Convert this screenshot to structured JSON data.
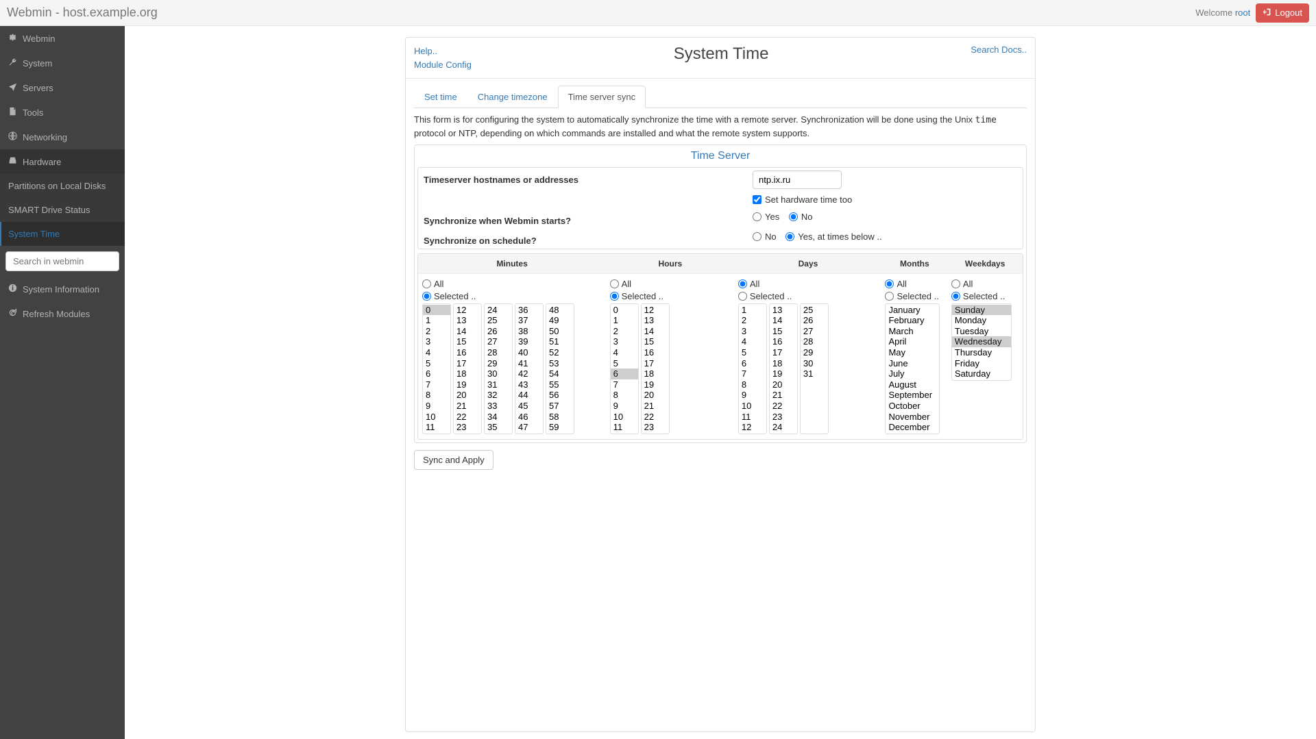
{
  "topbar": {
    "brand": "Webmin - host.example.org",
    "welcome_prefix": "Welcome ",
    "welcome_user": "root",
    "logout_label": "Logout"
  },
  "sidebar": {
    "items": [
      {
        "label": "Webmin",
        "icon": "gear"
      },
      {
        "label": "System",
        "icon": "wrench"
      },
      {
        "label": "Servers",
        "icon": "send"
      },
      {
        "label": "Tools",
        "icon": "file"
      },
      {
        "label": "Networking",
        "icon": "globe"
      },
      {
        "label": "Hardware",
        "icon": "hdd",
        "active": true
      }
    ],
    "subitems": [
      {
        "label": "Partitions on Local Disks"
      },
      {
        "label": "SMART Drive Status"
      },
      {
        "label": "System Time",
        "current": true
      }
    ],
    "search_placeholder": "Search in webmin",
    "footer_items": [
      {
        "label": "System Information",
        "icon": "info"
      },
      {
        "label": "Refresh Modules",
        "icon": "refresh"
      }
    ]
  },
  "header": {
    "help_link": "Help..",
    "config_link": "Module Config",
    "title": "System Time",
    "search_docs": "Search Docs.."
  },
  "tabs": [
    {
      "label": "Set time"
    },
    {
      "label": "Change timezone"
    },
    {
      "label": "Time server sync",
      "active": true
    }
  ],
  "description": {
    "before": "This form is for configuring the system to automatically synchronize the time with a remote server. Synchronization will be done using the Unix ",
    "code": "time",
    "after": " protocol or NTP, depending on which commands are installed and what the remote system supports."
  },
  "section": {
    "title": "Time Server",
    "hostnames_label": "Timeserver hostnames or addresses",
    "hostnames_value": "ntp.ix.ru",
    "hardware_label": "Set hardware time too",
    "hardware_checked": true,
    "sync_start_label": "Synchronize when Webmin starts?",
    "sync_start_yes": "Yes",
    "sync_start_no": "No",
    "sync_start_value": "no",
    "sync_sched_label": "Synchronize on schedule?",
    "sync_sched_no": "No",
    "sync_sched_yes": "Yes, at times below ..",
    "sync_sched_value": "yes"
  },
  "schedule": {
    "headers": {
      "minutes": "Minutes",
      "hours": "Hours",
      "days": "Days",
      "months": "Months",
      "weekdays": "Weekdays"
    },
    "all_label": "All",
    "selected_label": "Selected ..",
    "minutes": {
      "mode": "selected",
      "selected": [
        0
      ],
      "lists": [
        [
          0,
          1,
          2,
          3,
          4,
          5,
          6,
          7,
          8,
          9,
          10,
          11
        ],
        [
          12,
          13,
          14,
          15,
          16,
          17,
          18,
          19,
          20,
          21,
          22,
          23
        ],
        [
          24,
          25,
          26,
          27,
          28,
          29,
          30,
          31,
          32,
          33,
          34,
          35
        ],
        [
          36,
          37,
          38,
          39,
          40,
          41,
          42,
          43,
          44,
          45,
          46,
          47
        ],
        [
          48,
          49,
          50,
          51,
          52,
          53,
          54,
          55,
          56,
          57,
          58,
          59
        ]
      ]
    },
    "hours": {
      "mode": "selected",
      "selected": [
        6
      ],
      "lists": [
        [
          0,
          1,
          2,
          3,
          4,
          5,
          6,
          7,
          8,
          9,
          10,
          11
        ],
        [
          12,
          13,
          14,
          15,
          16,
          17,
          18,
          19,
          20,
          21,
          22,
          23
        ]
      ]
    },
    "days": {
      "mode": "all",
      "selected": [],
      "lists": [
        [
          1,
          2,
          3,
          4,
          5,
          6,
          7,
          8,
          9,
          10,
          11,
          12
        ],
        [
          13,
          14,
          15,
          16,
          17,
          18,
          19,
          20,
          21,
          22,
          23,
          24
        ],
        [
          25,
          26,
          27,
          28,
          29,
          30,
          31
        ]
      ]
    },
    "months": {
      "mode": "all",
      "selected": [],
      "list": [
        "January",
        "February",
        "March",
        "April",
        "May",
        "June",
        "July",
        "August",
        "September",
        "October",
        "November",
        "December"
      ]
    },
    "weekdays": {
      "mode": "selected",
      "selected": [
        "Sunday",
        "Wednesday"
      ],
      "list": [
        "Sunday",
        "Monday",
        "Tuesday",
        "Wednesday",
        "Thursday",
        "Friday",
        "Saturday"
      ]
    }
  },
  "submit_label": "Sync and Apply"
}
